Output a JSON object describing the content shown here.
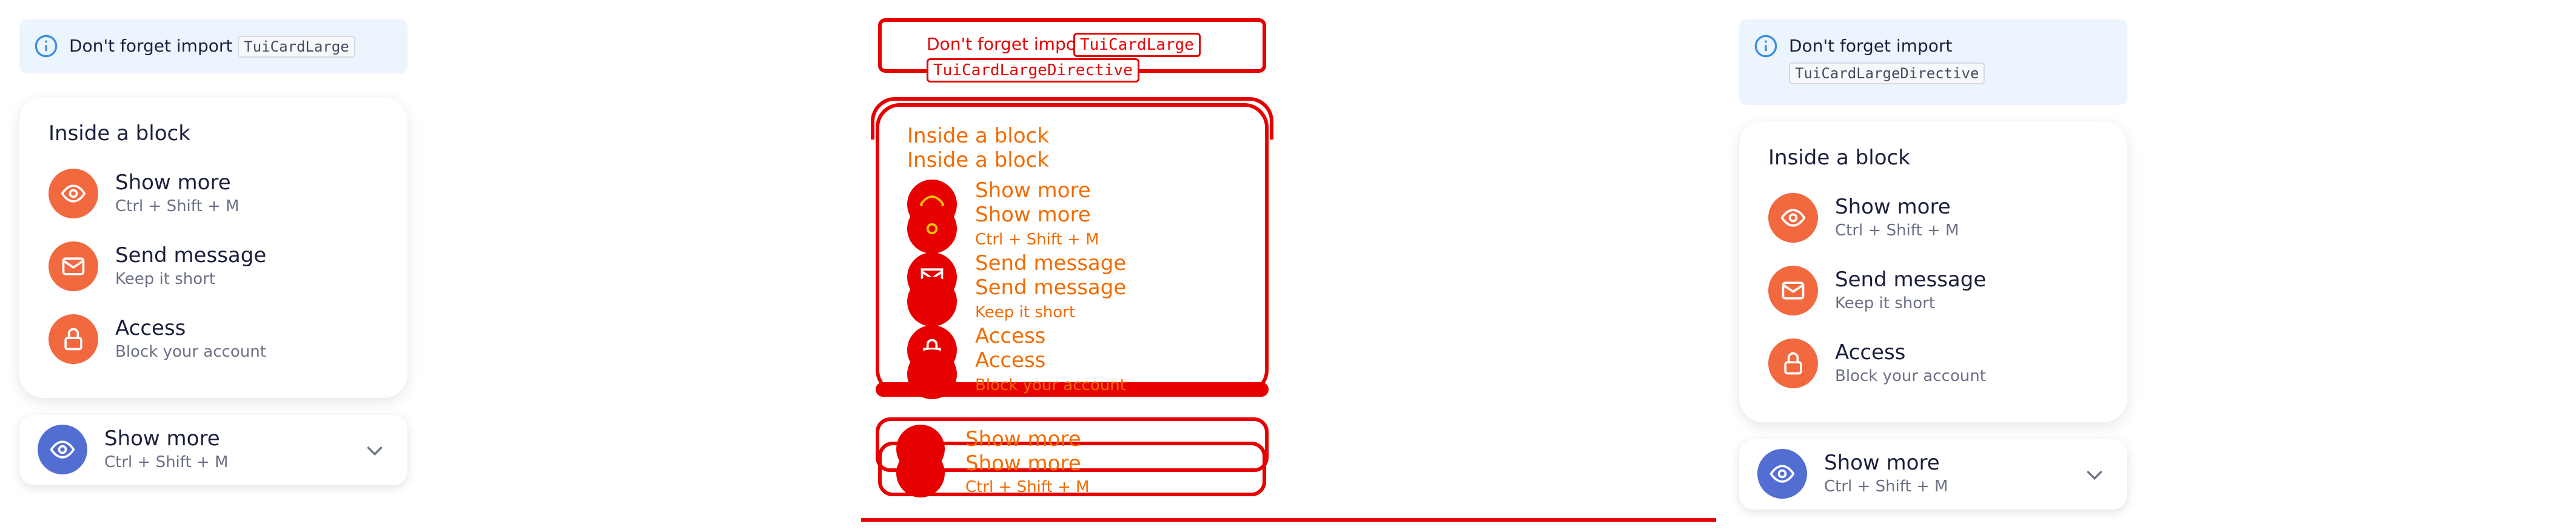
{
  "notice_left": {
    "text": "Don't forget import",
    "code": "TuiCardLarge"
  },
  "notice_right": {
    "text": "Don't forget import",
    "code": "TuiCardLargeDirective"
  },
  "card": {
    "title": "Inside a block",
    "items": [
      {
        "title": "Show more",
        "subtitle": "Ctrl + Shift + M",
        "icon": "eye-icon"
      },
      {
        "title": "Send message",
        "subtitle": "Keep it short",
        "icon": "mail-icon"
      },
      {
        "title": "Access",
        "subtitle": "Block your account",
        "icon": "lock-icon"
      }
    ]
  },
  "bar": {
    "title": "Show more",
    "subtitle": "Ctrl + Shift + M",
    "icon": "eye-icon"
  },
  "colors": {
    "accent_orange": "#f2683f",
    "accent_blue": "#526ed3",
    "notice_bg": "#ecf5fe",
    "overlay_red": "#e60000"
  }
}
